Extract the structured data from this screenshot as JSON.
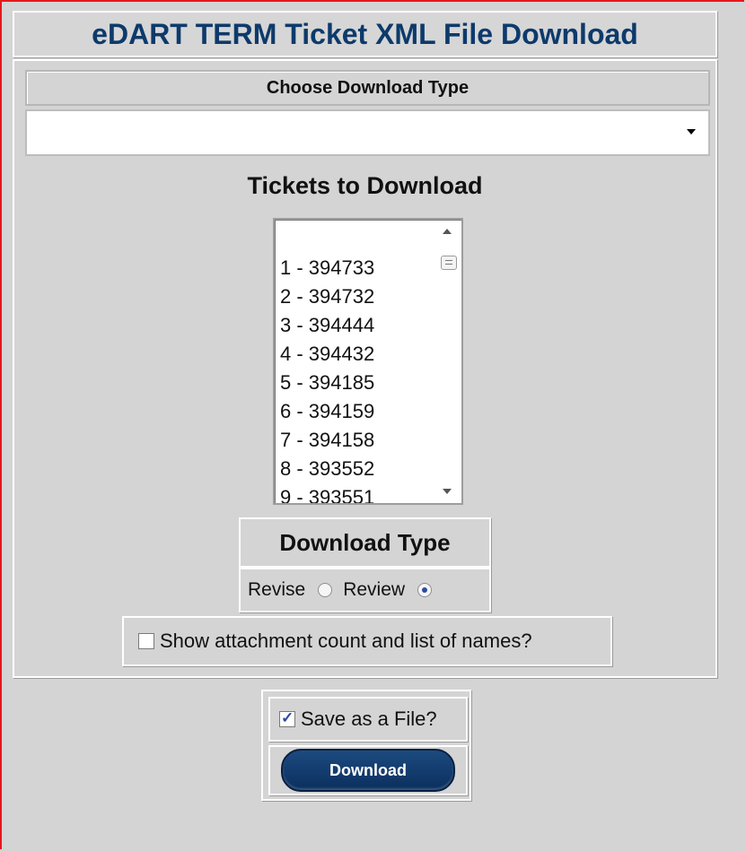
{
  "header": {
    "title": "eDART TERM Ticket XML File Download"
  },
  "choose": {
    "label": "Choose Download Type",
    "selected_value": ""
  },
  "tickets": {
    "title": "Tickets to Download",
    "items": [
      "1 - 394733",
      "2 - 394732",
      "3 - 394444",
      "4 - 394432",
      "5 - 394185",
      "6 - 394159",
      "7 - 394158",
      "8 - 393552",
      "9 - 393551"
    ]
  },
  "download_type": {
    "label": "Download Type",
    "options": [
      {
        "label": "Revise",
        "checked": false
      },
      {
        "label": "Review",
        "checked": true
      }
    ]
  },
  "attachments": {
    "label": "Show attachment count and list of names?",
    "checked": false
  },
  "save": {
    "label": "Save as a File?",
    "checked": true
  },
  "actions": {
    "download_label": "Download"
  },
  "colors": {
    "title": "#0d3a6b",
    "button": "#0b2f5e",
    "border_accent": "#e8171b"
  }
}
